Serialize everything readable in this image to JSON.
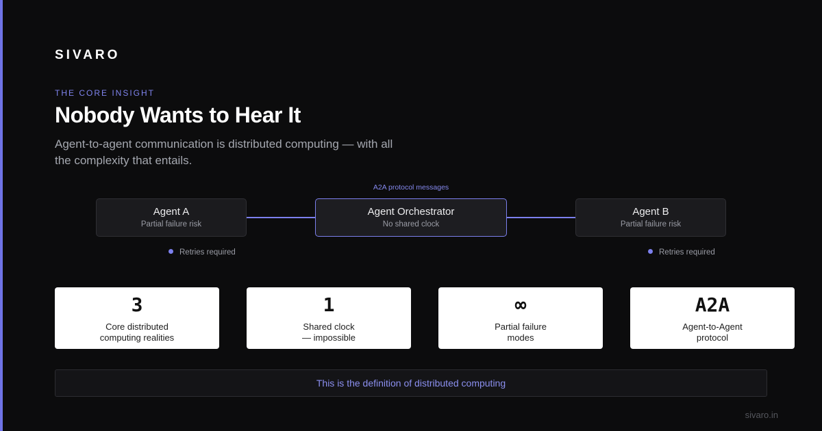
{
  "brand": "SIVARO",
  "eyebrow": "THE CORE INSIGHT",
  "title": "Nobody Wants to Hear It",
  "subtitle": "Agent-to-agent communication is distributed computing — with all the complexity that entails.",
  "diagram": {
    "caption": "A2A protocol messages",
    "nodes": [
      {
        "title": "Agent A",
        "subtitle": "Partial failure risk"
      },
      {
        "title": "Agent Orchestrator",
        "subtitle": "No shared clock"
      },
      {
        "title": "Agent B",
        "subtitle": "Partial failure risk"
      }
    ],
    "notes": [
      "Retries required",
      "Retries required"
    ]
  },
  "stats": [
    {
      "value": "3",
      "label_line1": "Core distributed",
      "label_line2": "computing realities"
    },
    {
      "value": "1",
      "label_line1": "Shared clock",
      "label_line2": "— impossible"
    },
    {
      "value": "∞",
      "label_line1": "Partial failure",
      "label_line2": "modes"
    },
    {
      "value": "A2A",
      "label_line1": "Agent-to-Agent",
      "label_line2": "protocol"
    }
  ],
  "callout": "This is the definition of distributed computing",
  "footer": "sivaro.in",
  "colors": {
    "accent": "#7c80ee",
    "background": "#0c0c0d",
    "card": "#ffffff"
  }
}
